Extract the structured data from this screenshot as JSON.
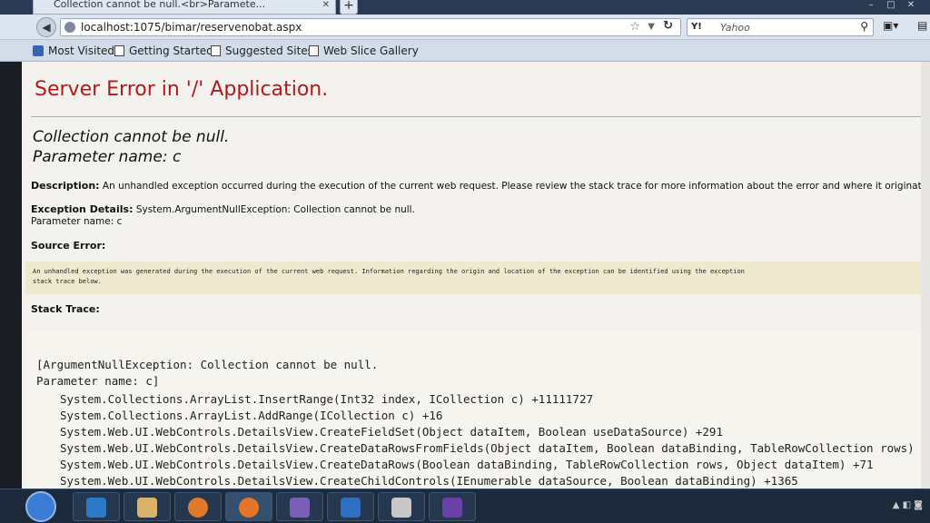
{
  "browser": {
    "tab_title": "Collection cannot be null.<br>Paramete...",
    "new_tab": "+",
    "url": "localhost:1075/bimar/reservenobat.aspx",
    "search_engine": "Y!",
    "search_placeholder": "Yahoo",
    "bookmarks": [
      "Most Visited",
      "Getting Started",
      "Suggested Sites",
      "Web Slice Gallery"
    ]
  },
  "page": {
    "title": "Server Error in '/' Application.",
    "error_line1": "Collection cannot be null.",
    "error_line2": "Parameter name: c",
    "description_label": "Description:",
    "description_text": "An unhandled exception occurred during the execution of the current web request. Please review the stack trace for more information about the error and where it originated in the code.",
    "exception_label": "Exception Details:",
    "exception_text": "System.ArgumentNullException: Collection cannot be null.",
    "exception_param": "Parameter name: c",
    "source_error_label": "Source Error:",
    "source_error_line1": "An unhandled exception was generated during the execution of the current web request. Information regarding the origin and location of the exception can be identified using the exception",
    "source_error_line2": "stack trace below.",
    "stack_trace_label": "Stack Trace:",
    "stack_header1": "[ArgumentNullException: Collection cannot be null.",
    "stack_header2": "Parameter name: c]",
    "stack_lines": [
      "System.Collections.ArrayList.InsertRange(Int32 index, ICollection c) +11111727",
      "System.Collections.ArrayList.AddRange(ICollection c) +16",
      "System.Web.UI.WebControls.DetailsView.CreateFieldSet(Object dataItem, Boolean useDataSource) +291",
      "System.Web.UI.WebControls.DetailsView.CreateDataRowsFromFields(Object dataItem, Boolean dataBinding, TableRowCollection rows) +",
      "System.Web.UI.WebControls.DetailsView.CreateDataRows(Boolean dataBinding, TableRowCollection rows, Object dataItem) +71",
      "System.Web.UI.WebControls.DetailsView.CreateChildControls(IEnumerable dataSource, Boolean dataBinding) +1365"
    ]
  },
  "colors": {
    "title_red": "#b01a1a",
    "source_bg": "#efe9cf",
    "page_bg": "#f4f2ee"
  },
  "icons": [
    "back-arrow-icon",
    "globe-icon",
    "star-icon",
    "reload-icon",
    "search-icon",
    "windows-start-icon",
    "ie-icon",
    "folder-icon",
    "media-player-icon",
    "firefox-icon",
    "visual-studio-icon"
  ]
}
